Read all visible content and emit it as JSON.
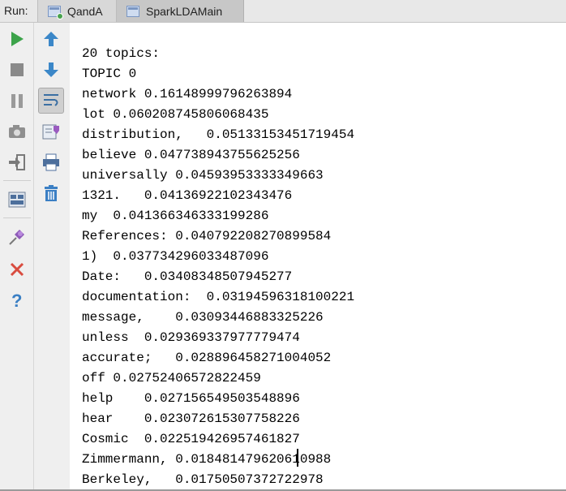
{
  "header": {
    "run_label": "Run:",
    "tabs": [
      {
        "label": "QandA"
      },
      {
        "label": "SparkLDAMain"
      }
    ]
  },
  "toolbar": {
    "left": [
      "run-icon",
      "stop-icon",
      "pause-icon",
      "camera-icon",
      "exit-icon",
      "layout-icon",
      "pin-icon",
      "close-icon",
      "help-icon"
    ],
    "right": [
      "arrow-up-icon",
      "arrow-down-icon",
      "soft-wrap-icon",
      "scroll-to-end-icon",
      "print-icon",
      "trash-icon"
    ]
  },
  "console": {
    "lines": [
      "20 topics:",
      "TOPIC 0",
      "network 0.16148999796263894",
      "lot 0.060208745806068435",
      "distribution,   0.05133153451719454",
      "believe 0.047738943755625256",
      "universally 0.04593953333349663",
      "1321.   0.04136922102343476",
      "my  0.041366346333199286",
      "References: 0.040792208270899584",
      "1)  0.037734296033487096",
      "Date:   0.03408348507945277",
      "documentation:  0.03194596318100221",
      "message,    0.03093446883325226",
      "unless  0.029369337977779474",
      "accurate;   0.028896458271004052",
      "off 0.02752406572822459",
      "help    0.027156549503548896",
      "hear    0.023072615307758226",
      "Cosmic  0.022519426957461827",
      "Zimmermann, 0.018481479620610988",
      "Berkeley,   0.01750507372722978"
    ]
  },
  "colors": {
    "run_green": "#3ca34a",
    "stop_gray": "#7e7e7e",
    "arrow_blue": "#3b87c8",
    "close_red": "#d94c3f",
    "help_blue": "#3a7fc4"
  }
}
